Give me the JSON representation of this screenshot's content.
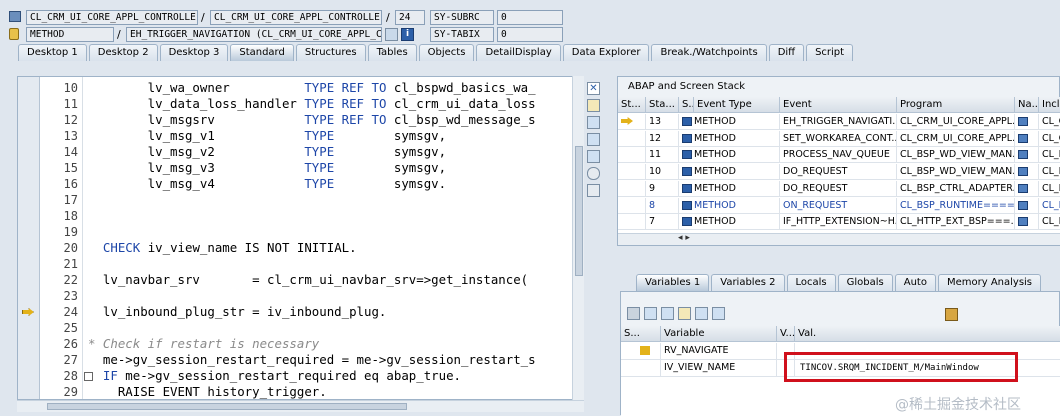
{
  "header": {
    "row1": {
      "f1": "CL_CRM_UI_CORE_APPL_CONTROLLE...",
      "sep1": "/",
      "f2": "CL_CRM_UI_CORE_APPL_CONTROLLE...",
      "sep2": "/",
      "f3": "24",
      "label": "SY-SUBRC",
      "value": "0"
    },
    "row2": {
      "f1": "METHOD",
      "sep1": "/",
      "f2": "EH_TRIGGER_NAVIGATION (CL_CRM_UI_CORE_APPL_C...",
      "label": "SY-TABIX",
      "value": "0"
    }
  },
  "tabs": [
    "Desktop 1",
    "Desktop 2",
    "Desktop 3",
    "Standard",
    "Structures",
    "Tables",
    "Objects",
    "DetailDisplay",
    "Data Explorer",
    "Break./Watchpoints",
    "Diff",
    "Script"
  ],
  "active_tab": "Standard",
  "code": [
    {
      "n": "10",
      "t": "        lv_wa_owner          ",
      "k": "TYPE REF TO",
      "r": " cl_bspwd_basics_wa_"
    },
    {
      "n": "11",
      "t": "        lv_data_loss_handler ",
      "k": "TYPE REF TO",
      "r": " cl_crm_ui_data_loss"
    },
    {
      "n": "12",
      "t": "        lv_msgsrv            ",
      "k": "TYPE REF TO",
      "r": " cl_bsp_wd_message_s"
    },
    {
      "n": "13",
      "t": "        lv_msg_v1            ",
      "k": "TYPE",
      "r": "        symsgv,"
    },
    {
      "n": "14",
      "t": "        lv_msg_v2            ",
      "k": "TYPE",
      "r": "        symsgv,"
    },
    {
      "n": "15",
      "t": "        lv_msg_v3            ",
      "k": "TYPE",
      "r": "        symsgv,"
    },
    {
      "n": "16",
      "t": "        lv_msg_v4            ",
      "k": "TYPE",
      "r": "        symsgv."
    },
    {
      "n": "17",
      "t": "",
      "k": "",
      "r": ""
    },
    {
      "n": "18",
      "t": "",
      "k": "",
      "r": ""
    },
    {
      "n": "19",
      "t": "",
      "k": "",
      "r": ""
    },
    {
      "n": "20",
      "t": "  ",
      "k": "CHECK",
      "r": " iv_view_name IS NOT INITIAL."
    },
    {
      "n": "21",
      "t": "",
      "k": "",
      "r": ""
    },
    {
      "n": "22",
      "t": "  lv_navbar_srv       = cl_crm_ui_navbar_srv=>get_instance(",
      "k": "",
      "r": ""
    },
    {
      "n": "23",
      "t": "",
      "k": "",
      "r": ""
    },
    {
      "n": "24",
      "t": "  lv_inbound_plug_str = iv_inbound_plug.",
      "k": "",
      "r": ""
    },
    {
      "n": "25",
      "t": "",
      "k": "",
      "r": ""
    },
    {
      "n": "26",
      "t": "",
      "k": "",
      "r": "",
      "c": "* Check if restart is necessary"
    },
    {
      "n": "27",
      "t": "  me->gv_session_restart_required = me->gv_session_restart_s",
      "k": "",
      "r": ""
    },
    {
      "n": "28",
      "t": "  ",
      "k": "IF",
      "r": " me->gv_session_restart_required eq abap_true."
    },
    {
      "n": "29",
      "t": "    RAISE EVENT history_trigger.",
      "k": "",
      "r": ""
    }
  ],
  "stack": {
    "title": "ABAP and Screen Stack",
    "columns": [
      "St...",
      "Sta...",
      "S...",
      "Event Type",
      "Event",
      "Program",
      "Na...",
      "Inclu"
    ],
    "rows": [
      {
        "sta": "13",
        "type": "METHOD",
        "event": "EH_TRIGGER_NAVIGATI...",
        "program": "CL_CRM_UI_CORE_APPL...",
        "incl": "CL_C"
      },
      {
        "sta": "12",
        "type": "METHOD",
        "event": "SET_WORKAREA_CONT...",
        "program": "CL_CRM_UI_CORE_APPL...",
        "incl": "CL_C"
      },
      {
        "sta": "11",
        "type": "METHOD",
        "event": "PROCESS_NAV_QUEUE",
        "program": "CL_BSP_WD_VIEW_MAN...",
        "incl": "CL_B"
      },
      {
        "sta": "10",
        "type": "METHOD",
        "event": "DO_REQUEST",
        "program": "CL_BSP_WD_VIEW_MAN...",
        "incl": "CL_B"
      },
      {
        "sta": "9",
        "type": "METHOD",
        "event": "DO_REQUEST",
        "program": "CL_BSP_CTRL_ADAPTER...",
        "incl": "CL_B"
      },
      {
        "sta": "8",
        "type": "METHOD",
        "event": "ON_REQUEST",
        "program": "CL_BSP_RUNTIME====...",
        "incl": "CL_B"
      },
      {
        "sta": "7",
        "type": "METHOD",
        "event": "IF_HTTP_EXTENSION~H...",
        "program": "CL_HTTP_EXT_BSP===...",
        "incl": "CL_H"
      }
    ]
  },
  "var_tabs": [
    "Variables 1",
    "Variables 2",
    "Locals",
    "Globals",
    "Auto",
    "Memory Analysis"
  ],
  "vars": {
    "columns": [
      "S...",
      "Variable",
      "V...",
      "Val."
    ],
    "rows": [
      {
        "name": "RV_NAVIGATE",
        "val": ""
      },
      {
        "name": "IV_VIEW_NAME",
        "val": "TINCOV.SRQM_INCIDENT_M/MainWindow"
      }
    ]
  },
  "watermark": "@稀土掘金技术社区",
  "colors": {
    "highlight_box": "#d0101c",
    "keyword": "#1d46a8",
    "accent": "#2c5fa8"
  }
}
